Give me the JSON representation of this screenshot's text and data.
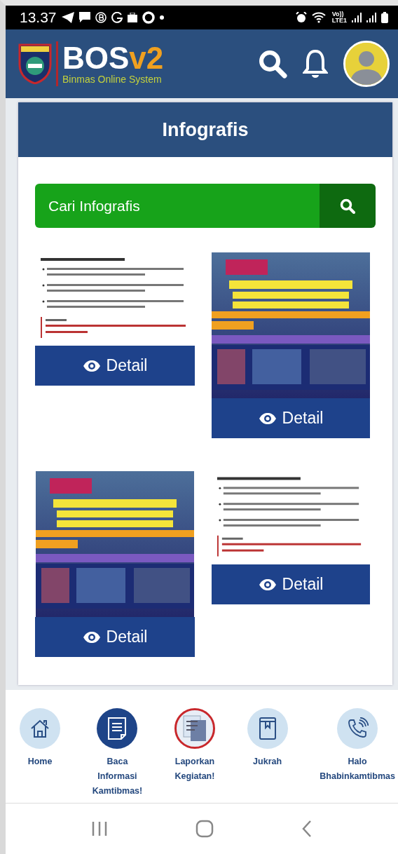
{
  "status_bar": {
    "time": "13.37",
    "network": [
      "Vo))",
      "LTE1"
    ]
  },
  "header": {
    "title": "BOS",
    "version": "v2",
    "subtitle": "Binmas Online System"
  },
  "page_title": "Infografis",
  "search": {
    "placeholder": "Cari Infografis"
  },
  "infographics": [
    {
      "kind": "article",
      "button": "Detail"
    },
    {
      "kind": "poster",
      "button": "Detail"
    },
    {
      "kind": "poster",
      "button": "Detail"
    },
    {
      "kind": "article",
      "button": "Detail"
    }
  ],
  "bottom_nav": [
    {
      "kind": "home",
      "label": "Home",
      "selected": false
    },
    {
      "kind": "document",
      "label": "Baca Informasi Kamtibmas!",
      "selected": true
    },
    {
      "kind": "image",
      "label": "Laporkan Kegiatan!",
      "selected": false
    },
    {
      "kind": "book",
      "label": "Jukrah",
      "selected": false
    },
    {
      "kind": "phone",
      "label": "Halo Bhabinkamtibmas",
      "selected": false
    }
  ]
}
